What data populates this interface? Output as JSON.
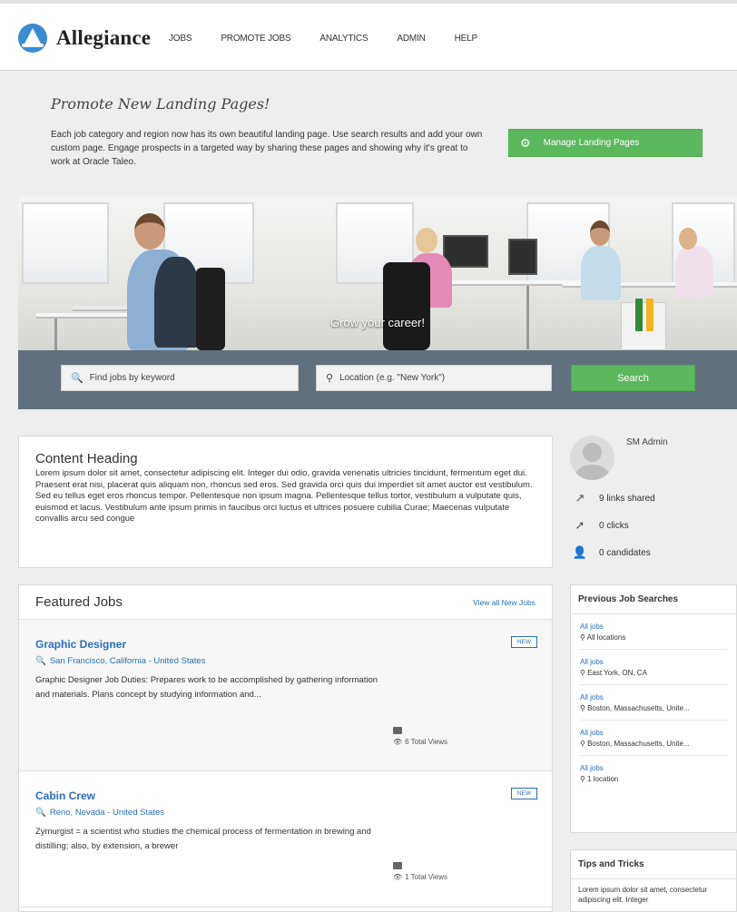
{
  "brand": {
    "name": "Allegiance"
  },
  "nav": [
    "JOBS",
    "PROMOTE JOBS",
    "ANALYTICS",
    "ADMIN",
    "HELP"
  ],
  "promo": {
    "title": "Promote New Landing Pages!",
    "text": "Each job category and region now has its own beautiful landing page. Use search results and add your own custom page. Engage prospects in a targeted way by sharing these pages and showing why it's great to work at Oracle Taleo.",
    "button": "Manage Landing Pages"
  },
  "hero": {
    "tagline": "Grow your career!",
    "keyword_placeholder": "Find jobs by keyword",
    "location_placeholder": "Location (e.g. \"New York\")",
    "search_button": "Search"
  },
  "content": {
    "heading": "Content Heading",
    "body": "Lorem ipsum dolor sit amet, consectetur adipiscing elit. Integer dui odio, gravida venenatis ultricies tincidunt, fermentum eget dui. Praesent erat nisi, placerat quis aliquam non, rhoncus sed eros. Sed gravida orci quis dui imperdiet sit amet auctor est vestibulum. Sed eu tellus eget eros rhoncus tempor. Pellentesque non ipsum magna. Pellentesque tellus tortor, vestibulum a vulputate quis, euismod et lacus. Vestibulum ante ipsum primis in faucibus orci luctus et ultrices posuere cubilia Curae; Maecenas vulputate convallis arcu sed congue"
  },
  "featured": {
    "title": "Featured Jobs",
    "view_all": "View all New Jobs",
    "jobs": [
      {
        "title": "Graphic Designer",
        "location": "San Francisco, California - United States",
        "description": "Graphic Designer Job Duties: Prepares work to be accomplished by gathering information and materials. Plans concept by studying information and...",
        "badge": "NEW",
        "views": "6 Total Views"
      },
      {
        "title": "Cabin Crew",
        "location": "Reno, Nevada - United States",
        "description": "Zymurgist = a scientist who studies the chemical process of fermentation in brewing and distilling; also, by extension, a brewer",
        "badge": "NEW",
        "views": "1 Total Views"
      }
    ]
  },
  "profile": {
    "name": "SM Admin",
    "stats": [
      "9 links shared",
      "0 clicks",
      "0 candidates"
    ]
  },
  "previous_searches": {
    "title": "Previous Job Searches",
    "items": [
      {
        "query": "All jobs",
        "location": "All locations"
      },
      {
        "query": "All jobs",
        "location": "East York, ON, CA"
      },
      {
        "query": "All jobs",
        "location": "Boston, Massachusetts, Unite..."
      },
      {
        "query": "All jobs",
        "location": "Boston, Massachusetts, Unite..."
      },
      {
        "query": "All jobs",
        "location": "1 location"
      }
    ]
  },
  "tips": {
    "title": "Tips and Tricks",
    "text": "Lorem ipsum dolor sit amet, consectetur adipiscing elit. Integer"
  },
  "colors": {
    "accent_green": "#5cb85c",
    "link_blue": "#2a6ebb",
    "search_band": "#61707d"
  }
}
